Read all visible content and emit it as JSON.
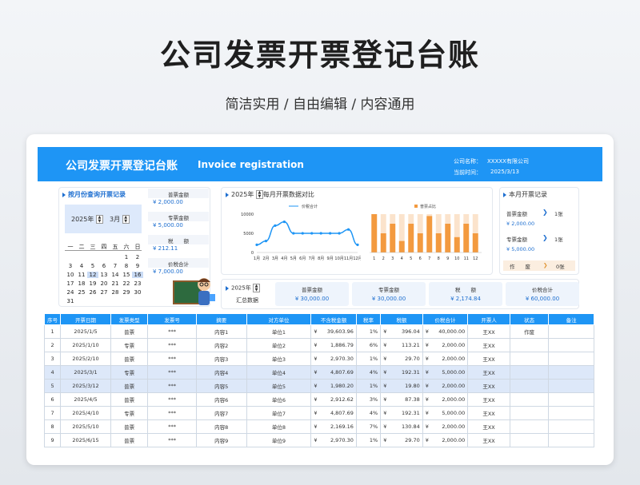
{
  "title": "公司发票开票登记台账",
  "subtitle": "简洁实用 / 自由编辑 / 内容通用",
  "header": {
    "title": "公司发票开票登记台账",
    "english": "Invoice registration",
    "company_label": "公司名称：",
    "company": "XXXXX有限公司",
    "date_label": "当前时间：",
    "date": "2025/3/13"
  },
  "query": {
    "title": "按月份查询开票记录",
    "year": "2025年",
    "month": "3月",
    "weekdays": [
      "一",
      "二",
      "三",
      "四",
      "五",
      "六",
      "日"
    ],
    "days": [
      "",
      "",
      "",
      "",
      "",
      "1",
      "2",
      "3",
      "4",
      "5",
      "6",
      "7",
      "8",
      "9",
      "10",
      "11",
      "12",
      "13",
      "14",
      "15",
      "16",
      "17",
      "18",
      "19",
      "20",
      "21",
      "22",
      "23",
      "24",
      "25",
      "26",
      "27",
      "28",
      "29",
      "30",
      "31"
    ],
    "highlight": [
      "12",
      "16"
    ]
  },
  "month_boxes": [
    {
      "label": "普票金额",
      "value": "¥ 2,000.00"
    },
    {
      "label": "专票金额",
      "value": "¥ 5,000.00"
    },
    {
      "label": "税　　额",
      "value": "¥ 212.11"
    },
    {
      "label": "价税合计",
      "value": "¥ 7,000.00"
    }
  ],
  "chart_panel": {
    "year": "2025年",
    "title": "每月开票数据对比"
  },
  "chart_data": [
    {
      "type": "line",
      "legend": "价税合计",
      "x": [
        "1月",
        "2月",
        "3月",
        "4月",
        "5月",
        "6月",
        "7月",
        "8月",
        "9月",
        "10月",
        "11月",
        "12月"
      ],
      "y_ticks": [
        "10000",
        "5000",
        "0"
      ],
      "ylim": [
        0,
        10000
      ],
      "values": [
        2000,
        3000,
        7000,
        8000,
        5000,
        5000,
        5000,
        5000,
        5000,
        5000,
        6000,
        2000
      ]
    },
    {
      "type": "bar",
      "legend": "普票占比",
      "x": [
        "1",
        "2",
        "3",
        "4",
        "5",
        "6",
        "7",
        "8",
        "9",
        "10",
        "11",
        "12"
      ],
      "values": [
        1,
        0.5,
        0.75,
        0.3,
        0.75,
        0.5,
        0.95,
        0.5,
        0.75,
        0.4,
        0.75,
        0.5
      ]
    }
  ],
  "current_month": {
    "title": "本月开票记录",
    "rows": [
      {
        "label": "普票金额",
        "count": "1张",
        "value": "¥ 2,000.00"
      },
      {
        "label": "专票金额",
        "count": "1张",
        "value": "¥ 5,000.00"
      }
    ],
    "void_label": "作　　废",
    "void_count": "0张"
  },
  "summary": {
    "year": "2025年",
    "label": "汇总数据",
    "boxes": [
      {
        "label": "普票金额",
        "value": "¥ 30,000.00"
      },
      {
        "label": "专票金额",
        "value": "¥ 30,000.00"
      },
      {
        "label": "税　　额",
        "value": "¥ 2,174.84"
      },
      {
        "label": "价税合计",
        "value": "¥ 60,000.00"
      }
    ]
  },
  "table": {
    "headers": [
      "序号",
      "开票日期",
      "发票类型",
      "发票号",
      "摘要",
      "对方单位",
      "不含税金额",
      "税率",
      "税额",
      "价税合计",
      "开票人",
      "状态",
      "备注"
    ],
    "rows": [
      [
        "1",
        "2025/1/5",
        "普票",
        "***",
        "内容1",
        "单位1",
        "39,603.96",
        "1%",
        "396.04",
        "40,000.00",
        "王XX",
        "作废",
        ""
      ],
      [
        "2",
        "2025/1/10",
        "专票",
        "***",
        "内容2",
        "单位2",
        "1,886.79",
        "6%",
        "113.21",
        "2,000.00",
        "王XX",
        "",
        ""
      ],
      [
        "3",
        "2025/2/10",
        "普票",
        "***",
        "内容3",
        "单位3",
        "2,970.30",
        "1%",
        "29.70",
        "2,000.00",
        "王XX",
        "",
        ""
      ],
      [
        "4",
        "2025/3/1",
        "专票",
        "***",
        "内容4",
        "单位4",
        "4,807.69",
        "4%",
        "192.31",
        "5,000.00",
        "王XX",
        "",
        ""
      ],
      [
        "5",
        "2025/3/12",
        "普票",
        "***",
        "内容5",
        "单位5",
        "1,980.20",
        "1%",
        "19.80",
        "2,000.00",
        "王XX",
        "",
        ""
      ],
      [
        "6",
        "2025/4/5",
        "普票",
        "***",
        "内容6",
        "单位6",
        "2,912.62",
        "3%",
        "87.38",
        "2,000.00",
        "王XX",
        "",
        ""
      ],
      [
        "7",
        "2025/4/10",
        "专票",
        "***",
        "内容7",
        "单位7",
        "4,807.69",
        "4%",
        "192.31",
        "5,000.00",
        "王XX",
        "",
        ""
      ],
      [
        "8",
        "2025/5/10",
        "普票",
        "***",
        "内容8",
        "单位8",
        "2,169.16",
        "7%",
        "130.84",
        "2,000.00",
        "王XX",
        "",
        ""
      ],
      [
        "9",
        "2025/6/15",
        "普票",
        "***",
        "内容9",
        "单位9",
        "2,970.30",
        "1%",
        "29.70",
        "2,000.00",
        "王XX",
        "",
        ""
      ]
    ],
    "currency": "¥"
  }
}
